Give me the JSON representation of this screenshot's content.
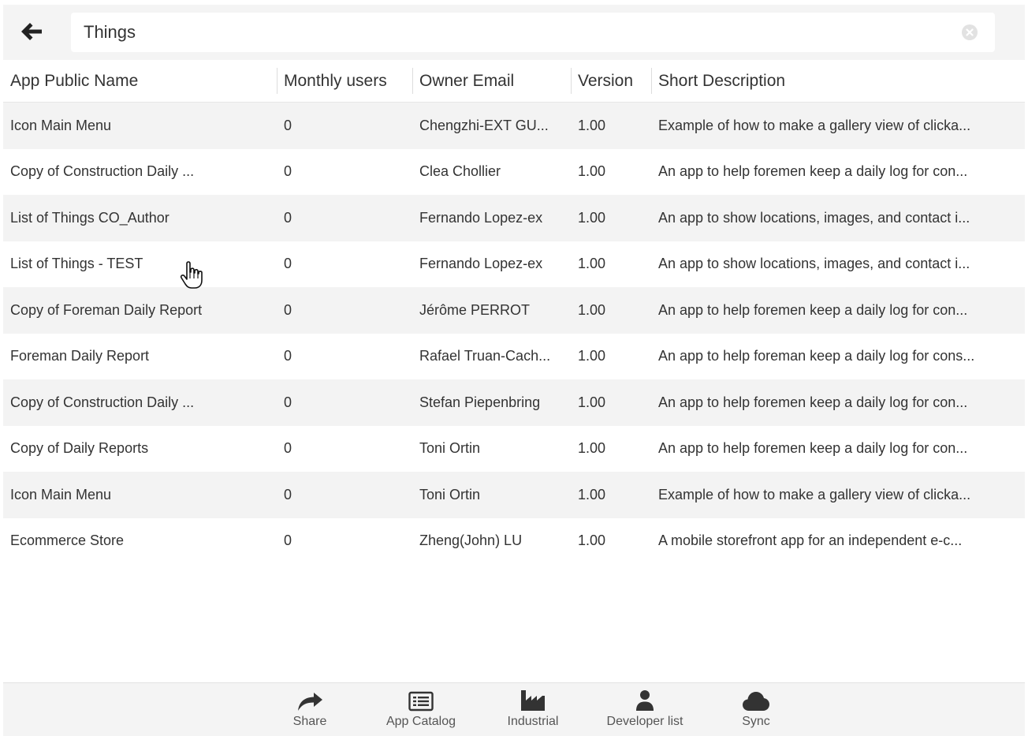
{
  "search": {
    "value": "Things"
  },
  "table": {
    "headers": [
      "App Public Name",
      "Monthly users",
      "Owner Email",
      "Version",
      "Short Description"
    ],
    "rows": [
      [
        "Icon Main Menu",
        "0",
        "Chengzhi-EXT GU...",
        "1.00",
        "Example of how to make a gallery view of clicka..."
      ],
      [
        "Copy of Construction Daily ...",
        "0",
        "Clea Chollier",
        "1.00",
        "An app to help foremen keep a daily log for con..."
      ],
      [
        "List of Things CO_Author",
        "0",
        "Fernando Lopez-ex",
        "1.00",
        "An app to show locations, images, and contact i..."
      ],
      [
        "List of Things - TEST",
        "0",
        "Fernando Lopez-ex",
        "1.00",
        "An app to show locations, images, and contact i..."
      ],
      [
        "Copy of Foreman Daily Report",
        "0",
        "Jérôme PERROT",
        "1.00",
        "An app to help foremen keep a daily log for con..."
      ],
      [
        "Foreman Daily Report",
        "0",
        "Rafael Truan-Cach...",
        "1.00",
        "An app to help foreman keep a daily log for cons..."
      ],
      [
        "Copy of Construction Daily ...",
        "0",
        "Stefan Piepenbring",
        "1.00",
        "An app to help foremen keep a daily log for con..."
      ],
      [
        "Copy of Daily Reports",
        "0",
        "Toni Ortin",
        "1.00",
        "An app to help foremen keep a daily log for con..."
      ],
      [
        "Icon Main Menu",
        "0",
        "Toni Ortin",
        "1.00",
        "Example of how to make a gallery view of clicka..."
      ],
      [
        "Ecommerce Store",
        "0",
        "Zheng(John) LU",
        "1.00",
        "A mobile storefront app for an independent e-c..."
      ]
    ]
  },
  "bottom_nav": {
    "items": [
      {
        "label": "Share",
        "icon": "share-icon"
      },
      {
        "label": "App Catalog",
        "icon": "catalog-icon"
      },
      {
        "label": "Industrial",
        "icon": "factory-icon"
      },
      {
        "label": "Developer list",
        "icon": "user-icon"
      },
      {
        "label": "Sync",
        "icon": "cloud-icon"
      }
    ]
  },
  "colors": {
    "background": "#ffffff",
    "header_bg": "#f4f4f4",
    "row_alt": "#f3f3f3",
    "text": "#333333",
    "icon": "#333333"
  }
}
